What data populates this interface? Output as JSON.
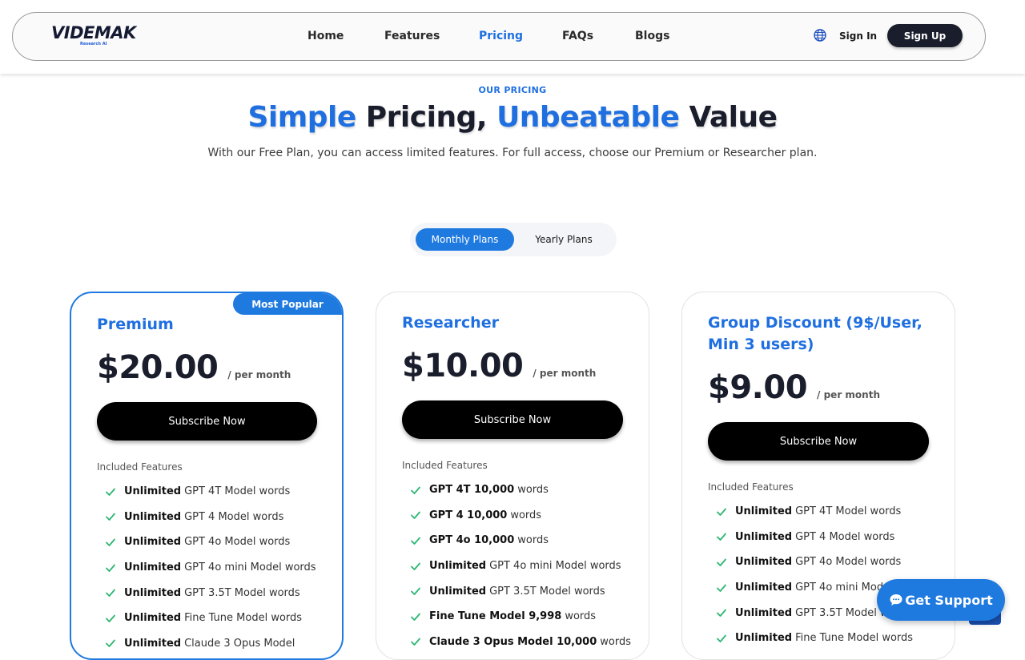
{
  "header": {
    "logo_text": "VIDEMAK",
    "logo_sub": "Research AI",
    "nav": [
      {
        "label": "Home",
        "active": false
      },
      {
        "label": "Features",
        "active": false
      },
      {
        "label": "Pricing",
        "active": true
      },
      {
        "label": "FAQs",
        "active": false
      },
      {
        "label": "Blogs",
        "active": false
      }
    ],
    "language_icon": "globe-icon",
    "sign_in": "Sign In",
    "sign_up": "Sign Up"
  },
  "hero": {
    "eyebrow": "OUR PRICING",
    "title_part1": "Simple",
    "title_part2": " Pricing, ",
    "title_part3": "Unbeatable",
    "title_part4": " Value",
    "subtitle": "With our Free Plan, you can access limited features. For full access, choose our Premium or Researcher plan."
  },
  "toggle": {
    "monthly": "Monthly Plans",
    "yearly": "Yearly Plans",
    "selected": "monthly"
  },
  "plans": [
    {
      "name": "Premium",
      "badge": "Most Popular",
      "price": "$20.00",
      "period": "/ per month",
      "cta": "Subscribe Now",
      "included_label": "Included Features",
      "features": [
        {
          "bold": "Unlimited",
          "text": "GPT 4T Model words"
        },
        {
          "bold": "Unlimited",
          "text": "GPT 4 Model words"
        },
        {
          "bold": "Unlimited",
          "text": "GPT 4o Model words"
        },
        {
          "bold": "Unlimited",
          "text": "GPT 4o mini Model words"
        },
        {
          "bold": "Unlimited",
          "text": "GPT 3.5T Model words"
        },
        {
          "bold": "Unlimited",
          "text": "Fine Tune Model words"
        },
        {
          "bold": "Unlimited",
          "text": "Claude 3 Opus Model"
        }
      ]
    },
    {
      "name": "Researcher",
      "badge": "",
      "price": "$10.00",
      "period": "/ per month",
      "cta": "Subscribe Now",
      "included_label": "Included Features",
      "features": [
        {
          "bold": "GPT 4T 10,000",
          "text": "words"
        },
        {
          "bold": "GPT 4 10,000",
          "text": "words"
        },
        {
          "bold": "GPT 4o 10,000",
          "text": "words"
        },
        {
          "bold": "Unlimited",
          "text": "GPT 4o mini Model words"
        },
        {
          "bold": "Unlimited",
          "text": "GPT 3.5T Model words"
        },
        {
          "bold": "Fine Tune Model 9,998",
          "text": "words"
        },
        {
          "bold": "Claude 3 Opus Model 10,000",
          "text": "words"
        }
      ]
    },
    {
      "name": "Group Discount (9$/User, Min 3 users)",
      "badge": "",
      "price": "$9.00",
      "period": "/ per month",
      "cta": "Subscribe Now",
      "included_label": "Included Features",
      "features": [
        {
          "bold": "Unlimited",
          "text": "GPT 4T Model words"
        },
        {
          "bold": "Unlimited",
          "text": "GPT 4 Model words"
        },
        {
          "bold": "Unlimited",
          "text": "GPT 4o Model words"
        },
        {
          "bold": "Unlimited",
          "text": "GPT 4o mini Model words"
        },
        {
          "bold": "Unlimited",
          "text": "GPT 3.5T Model words"
        },
        {
          "bold": "Unlimited",
          "text": "Fine Tune Model words"
        }
      ]
    }
  ],
  "support": {
    "label": "Get Support",
    "icon": "chat-bubble-icon"
  },
  "colors": {
    "accent": "#1f7ae0",
    "dark": "#1a1d2b",
    "check": "#2bb673"
  }
}
